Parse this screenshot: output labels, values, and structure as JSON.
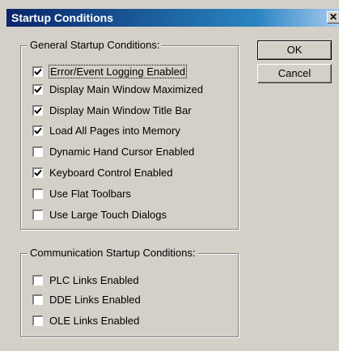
{
  "window": {
    "title": "Startup Conditions",
    "close_glyph": "✕"
  },
  "general": {
    "title": "General Startup Conditions:",
    "items": [
      {
        "label": "Error/Event Logging Enabled",
        "checked": true
      },
      {
        "label": "Display Main Window Maximized",
        "checked": true
      },
      {
        "label": "Display Main Window Title Bar",
        "checked": true
      },
      {
        "label": "Load All Pages into Memory",
        "checked": true
      },
      {
        "label": "Dynamic Hand Cursor Enabled",
        "checked": false
      },
      {
        "label": "Keyboard Control Enabled",
        "checked": true
      },
      {
        "label": "Use Flat Toolbars",
        "checked": false
      },
      {
        "label": "Use Large Touch Dialogs",
        "checked": false
      }
    ]
  },
  "communication": {
    "title": "Communication Startup Conditions:",
    "items": [
      {
        "label": "PLC Links Enabled",
        "checked": false
      },
      {
        "label": "DDE Links Enabled",
        "checked": false
      },
      {
        "label": "OLE Links Enabled",
        "checked": false
      }
    ]
  },
  "buttons": {
    "ok": "OK",
    "cancel": "Cancel"
  }
}
